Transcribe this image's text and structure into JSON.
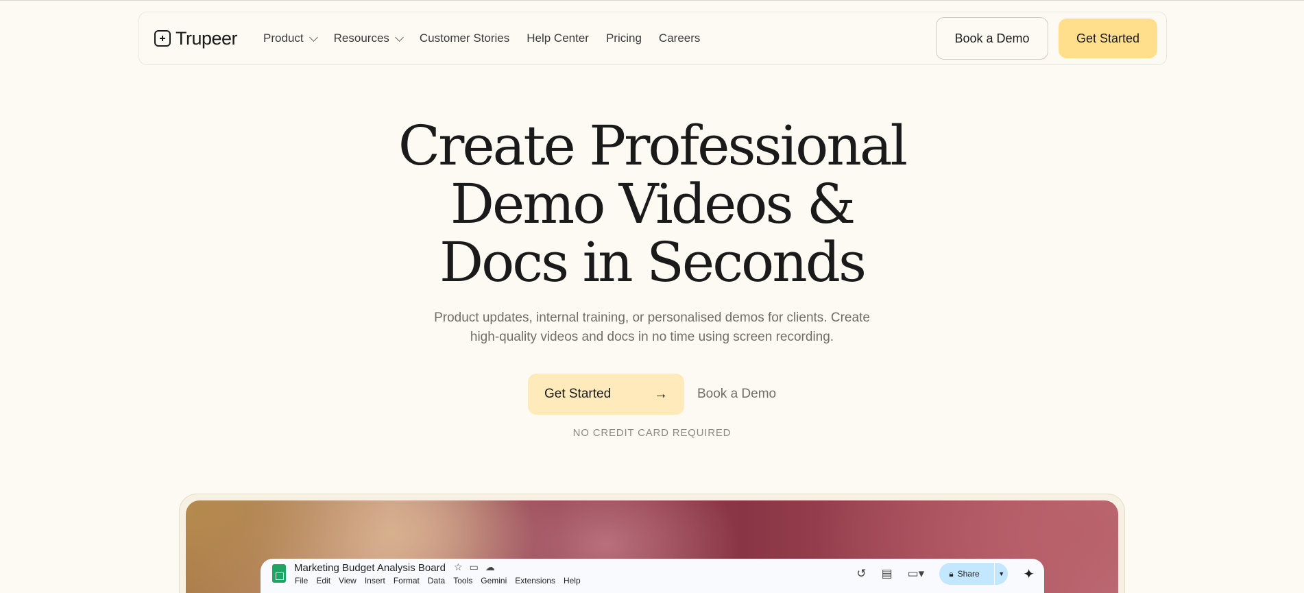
{
  "nav": {
    "logo_text": "Trupeer",
    "links": [
      {
        "label": "Product",
        "has_dropdown": true
      },
      {
        "label": "Resources",
        "has_dropdown": true
      },
      {
        "label": "Customer Stories",
        "has_dropdown": false
      },
      {
        "label": "Help Center",
        "has_dropdown": false
      },
      {
        "label": "Pricing",
        "has_dropdown": false
      },
      {
        "label": "Careers",
        "has_dropdown": false
      }
    ],
    "book_demo_label": "Book a Demo",
    "get_started_label": "Get Started"
  },
  "hero": {
    "title_lines": [
      "Create Professional",
      "Demo Videos &",
      "Docs in Seconds"
    ],
    "subtitle_lines": [
      "Product updates, internal training, or personalised demos for clients. Create",
      "high-quality videos and docs in no time using screen recording."
    ],
    "primary_cta": "Get Started",
    "secondary_cta": "Book a Demo",
    "note": "NO CREDIT CARD REQUIRED"
  },
  "preview": {
    "sheet_title": "Marketing Budget Analysis Board",
    "menu": [
      "File",
      "Edit",
      "View",
      "Insert",
      "Format",
      "Data",
      "Tools",
      "Gemini",
      "Extensions",
      "Help"
    ],
    "share_label": "Share"
  },
  "icons": {
    "logo": "trupeer-logo-icon",
    "arrow": "arrow-right-icon",
    "star": "star-icon",
    "folder": "move-folder-icon",
    "cloud": "cloud-status-icon",
    "history": "history-icon",
    "comment": "comment-icon",
    "meet": "video-camera-icon",
    "lock": "lock-icon",
    "gemini": "sparkle-icon"
  },
  "colors": {
    "background": "#fdfaf3",
    "accent_yellow": "#ffdf8c",
    "cta_yellow": "#ffeabb",
    "share_blue": "#c2e7ff",
    "sheets_green": "#1fa463"
  }
}
